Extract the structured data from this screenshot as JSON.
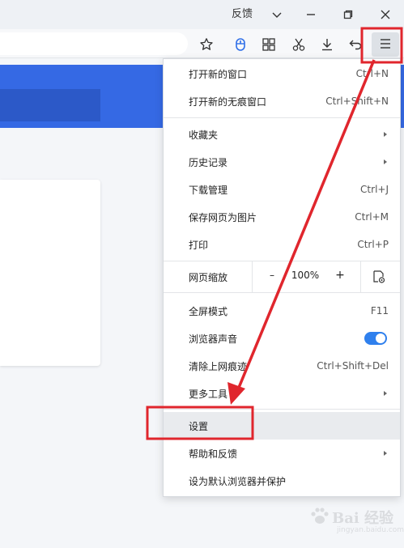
{
  "titlebar": {
    "feedback_label": "反馈",
    "icons": [
      "chevron-down-icon",
      "minimize-icon",
      "restore-icon",
      "close-icon"
    ]
  },
  "toolbar": {
    "icons": [
      "star-icon",
      "mouse-icon",
      "apps-grid-icon",
      "scissors-icon",
      "download-icon",
      "undo-icon",
      "menu-icon"
    ]
  },
  "menu": {
    "items": [
      {
        "label": "打开新的窗口",
        "shortcut": "Ctrl+N"
      },
      {
        "label": "打开新的无痕窗口",
        "shortcut": "Ctrl+Shift+N"
      },
      {
        "label": "收藏夹",
        "shortcut": ""
      },
      {
        "label": "历史记录",
        "shortcut": ""
      },
      {
        "label": "下载管理",
        "shortcut": "Ctrl+J"
      },
      {
        "label": "保存网页为图片",
        "shortcut": "Ctrl+M"
      },
      {
        "label": "打印",
        "shortcut": "Ctrl+P"
      },
      {
        "label": "全屏模式",
        "shortcut": "F11"
      },
      {
        "label": "浏览器声音",
        "shortcut": ""
      },
      {
        "label": "清除上网痕迹",
        "shortcut": "Ctrl+Shift+Del"
      },
      {
        "label": "更多工具",
        "shortcut": ""
      },
      {
        "label": "设置",
        "shortcut": ""
      },
      {
        "label": "帮助和反馈",
        "shortcut": ""
      },
      {
        "label": "设为默认浏览器并保护",
        "shortcut": ""
      }
    ],
    "zoom": {
      "label": "网页缩放",
      "minus": "–",
      "value": "100%",
      "plus": "+"
    },
    "sound_enabled": true
  },
  "watermark": {
    "text": "Bai 经验",
    "sub": "jingyan.baidu.com"
  },
  "colors": {
    "accent_blue": "#3569e4",
    "toggle_blue": "#2f80ed",
    "annotation_red": "#e0262d",
    "highlight_gray": "#e9ebee"
  }
}
